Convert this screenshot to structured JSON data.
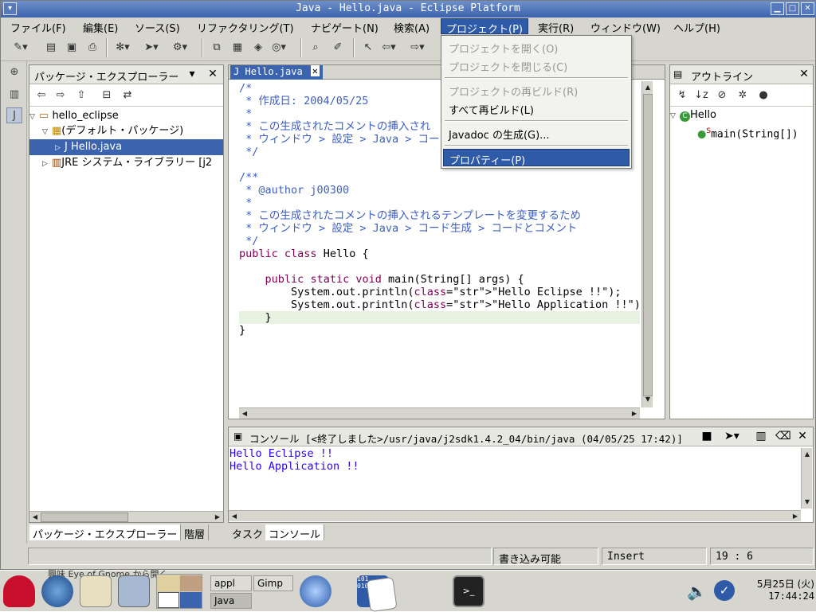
{
  "window": {
    "title": "Java - Hello.java - Eclipse Platform"
  },
  "menubar": [
    {
      "label": "ファイル(F)"
    },
    {
      "label": "編集(E)"
    },
    {
      "label": "ソース(S)"
    },
    {
      "label": "リファクタリング(T)"
    },
    {
      "label": "ナビゲート(N)"
    },
    {
      "label": "検索(A)"
    },
    {
      "label": "プロジェクト(P)"
    },
    {
      "label": "実行(R)"
    },
    {
      "label": "ウィンドウ(W)"
    },
    {
      "label": "ヘルプ(H)"
    }
  ],
  "project_menu": {
    "open_project": "プロジェクトを開く(O)",
    "close_project": "プロジェクトを閉じる(C)",
    "rebuild_project": "プロジェクトの再ビルド(R)",
    "rebuild_all": "すべて再ビルド(L)",
    "javadoc": "Javadoc の生成(G)...",
    "properties": "プロパティー(P)"
  },
  "package_explorer": {
    "title": "パッケージ・エクスプローラー",
    "tree": {
      "project": "hello_eclipse",
      "package": "(デフォルト・パッケージ)",
      "file": "Hello.java",
      "library": "JRE システム・ライブラリー [j2"
    },
    "bottom_tabs": [
      "パッケージ・エクスプローラー",
      "階層"
    ]
  },
  "editor": {
    "tab": "Hello.java",
    "lines": [
      "/*",
      " * 作成日: 2004/05/25",
      " *",
      " * この生成されたコメントの挿入され",
      " * ウィンドウ > 設定 > Java > コー",
      " */",
      "",
      "/**",
      " * @author j00300",
      " *",
      " * この生成されたコメントの挿入されるテンプレートを変更するため",
      " * ウィンドウ > 設定 > Java > コード生成 > コードとコメント",
      " */",
      "public class Hello {",
      "",
      "    public static void main(String[] args) {",
      "        System.out.println(\"Hello Eclipse !!\");",
      "        System.out.println(\"Hello Application !!\");",
      "    }",
      "}"
    ]
  },
  "outline": {
    "title": "アウトライン",
    "class_name": "Hello",
    "method": "main(String[])",
    "static_marker": "S"
  },
  "console": {
    "title": "コンソール [<終了しました>/usr/java/j2sdk1.4.2_04/bin/java (04/05/25 17:42)]",
    "output": [
      "Hello Eclipse !!",
      "Hello Application !!"
    ],
    "bottom_tabs": [
      "タスク",
      "コンソール"
    ]
  },
  "status": {
    "writable": "書き込み可能",
    "mode": "Insert",
    "position": "19 : 6"
  },
  "taskbar": {
    "tasks": [
      "appl",
      "Gimp",
      "Java"
    ],
    "date": "5月25日 (火)",
    "time": "17:44:24",
    "behind_text": "興味 Eye of Gnome から開く"
  }
}
